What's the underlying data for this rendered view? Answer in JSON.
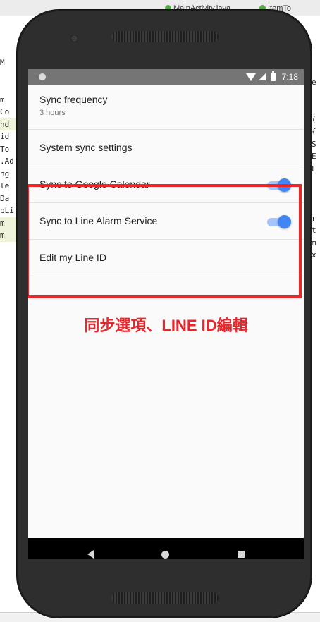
{
  "ide": {
    "tab1": "MainActivity.java",
    "tab2": "ItemTo",
    "left_code": [
      "M",
      "",
      "",
      "m",
      "Co",
      "nd",
      "id",
      "To",
      ".Ad",
      "ng",
      "le",
      "Da",
      "pLi",
      "m",
      "m"
    ],
    "right_code": [
      "e",
      "",
      "",
      "(",
      "{",
      "S",
      "E",
      "L",
      "",
      "",
      "",
      "r",
      "t",
      "m",
      "x"
    ]
  },
  "status_bar": {
    "time": "7:18",
    "icons": [
      "wifi-icon",
      "signal-icon",
      "battery-icon"
    ]
  },
  "settings": {
    "sync_frequency": {
      "title": "Sync frequency",
      "summary": "3 hours"
    },
    "system_sync": {
      "title": "System sync settings"
    },
    "google_calendar": {
      "title": "Sync to Google Calendar",
      "enabled": true
    },
    "line_alarm": {
      "title": "Sync to Line Alarm Service",
      "enabled": true
    },
    "edit_line_id": {
      "title": "Edit my Line ID"
    }
  },
  "annotation": {
    "caption": "同步選項、LINE ID編輯",
    "color": "#e8262b"
  },
  "nav_bar": {
    "icons": [
      "back-icon",
      "home-icon",
      "recents-icon"
    ]
  },
  "colors": {
    "accent": "#4285f4",
    "status_bar": "#757575",
    "nav_bar": "#000000"
  }
}
